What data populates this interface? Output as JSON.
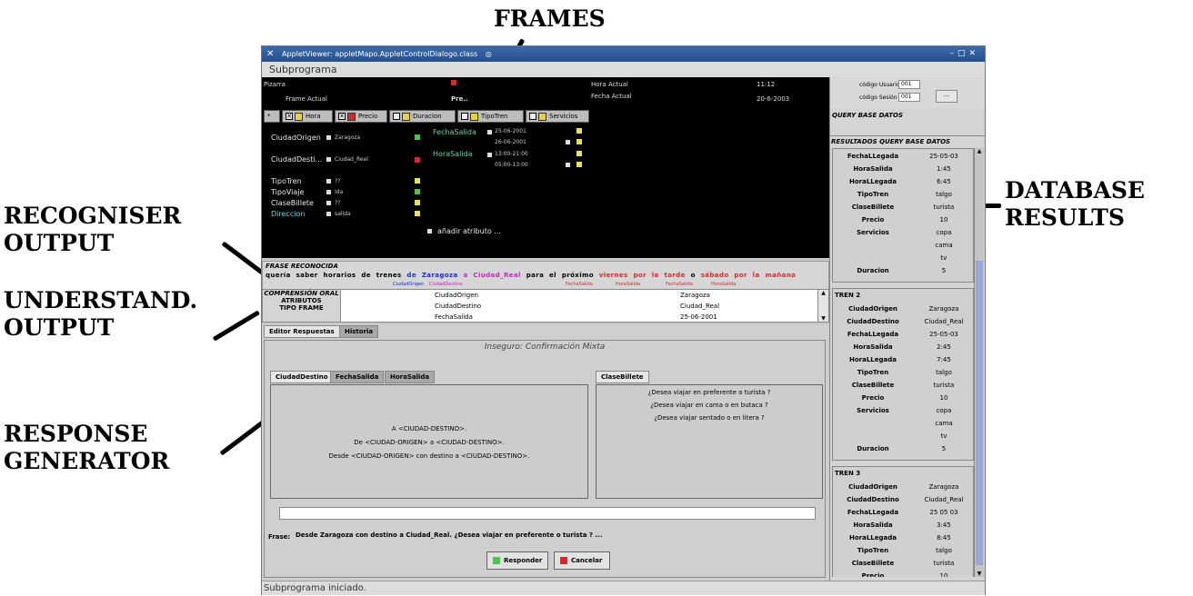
{
  "annotations": {
    "frames": "FRAMES",
    "recogniser": [
      "RECOGNISER",
      "OUTPUT"
    ],
    "understand": [
      "UNDERSTAND.",
      "OUTPUT"
    ],
    "response": [
      "RESPONSE",
      "GENERATOR"
    ],
    "database": [
      "DATABASE",
      "RESULTS"
    ]
  },
  "window": {
    "title": "AppletViewer: appletMapo.AppletControlDialogo.class",
    "menu": "Subprograma",
    "status": "Subprograma iniciado."
  },
  "header": {
    "pizarra": "Pizarra",
    "frame_actual_label": "Frame Actual",
    "frame_actual_value": "Pre..",
    "hora_actual_label": "Hora Actual",
    "hora_actual_value": "11:12",
    "fecha_actual_label": "Fecha Actual",
    "fecha_actual_value": "20-6-2003"
  },
  "frame_tabs": [
    {
      "label": "Hora",
      "color": "#e8d23a"
    },
    {
      "label": "Precio",
      "color": "#d42a2a"
    },
    {
      "label": "Duracion",
      "color": "#e8d23a"
    },
    {
      "label": "TipoTren",
      "color": "#e8d23a"
    },
    {
      "label": "Servicios",
      "color": "#e8d23a"
    }
  ],
  "slots_left": [
    {
      "name": "CiudadOrigen",
      "value": "Zaragoza",
      "color": "#4bc44b"
    },
    {
      "name": "CiudadDesti...",
      "value": "Ciudad_Real",
      "color": "#d42a2a"
    },
    {
      "name": "TipoTren",
      "value": "??",
      "color": "#e8e25a"
    },
    {
      "name": "TipoViaje",
      "value": "Ida",
      "color": "#4bc44b"
    },
    {
      "name": "ClaseBillete",
      "value": "??",
      "color": "#e8e25a"
    },
    {
      "name": "Direccion",
      "value": "salida",
      "color": "#e8e25a"
    }
  ],
  "slots_right": {
    "fecha_label": "FechaSalida",
    "fecha_values": [
      "25-06-2001",
      "26-06-2001"
    ],
    "hora_label": "HoraSalida",
    "hora_values": [
      "13:00-21:00",
      "05:00-13:00"
    ],
    "add_attr": "añadir atributo ..."
  },
  "recognised": {
    "label": "FRASE RECONOCIDA",
    "words": [
      {
        "t": "quería saber horarios de trenes",
        "c": "#000000"
      },
      {
        "t": "de",
        "c": "#1a2ccf"
      },
      {
        "t": "Zaragoza",
        "c": "#1a2ccf"
      },
      {
        "t": "a",
        "c": "#c425c4"
      },
      {
        "t": "Ciudad_Real",
        "c": "#c425c4"
      },
      {
        "t": "para el próximo",
        "c": "#000000"
      },
      {
        "t": "viernes",
        "c": "#d42a2a"
      },
      {
        "t": "por la tarde",
        "c": "#d42a2a"
      },
      {
        "t": "o",
        "c": "#000000"
      },
      {
        "t": "sábado",
        "c": "#d42a2a"
      },
      {
        "t": "por la mañana",
        "c": "#d42a2a"
      }
    ],
    "sublabels": [
      {
        "t": "CiudadOrigen",
        "c": "#1a2ccf"
      },
      {
        "t": "CiudadDestino",
        "c": "#c425c4"
      },
      {
        "t": "FechaSalida",
        "c": "#d42a2a"
      },
      {
        "t": "HoraSalida",
        "c": "#d42a2a"
      },
      {
        "t": "FechaSalida",
        "c": "#d42a2a"
      },
      {
        "t": "HoraSalida",
        "c": "#d42a2a"
      }
    ]
  },
  "comprension": {
    "label": "COMPRENSIÓN ORAL",
    "atributos": "ATRIBUTOS",
    "tipo_frame": "TIPO FRAME",
    "rows": [
      {
        "attr": "CiudadOrigen",
        "value": "Zaragoza"
      },
      {
        "attr": "CiudadDestino",
        "value": "Ciudad_Real"
      },
      {
        "attr": "FechaSalida",
        "value": "25-06-2001"
      }
    ]
  },
  "responses": {
    "tabs": [
      "Editor Respuestas",
      "Historia"
    ],
    "heading": "Inseguro: Confirmación Mixta",
    "left_tabs": [
      "CiudadDestino",
      "FechaSalida",
      "HoraSalida"
    ],
    "right_tab": "ClaseBillete",
    "left_lines": [
      "A <CIUDAD-DESTINO>.",
      "De <CIUDAD-ORIGEN> a <CIUDAD-DESTINO>.",
      "Desde <CIUDAD-ORIGEN> con destino a <CIUDAD-DESTINO>."
    ],
    "right_lines": [
      "¿Desea viajar en preferente o turista ?",
      "¿Desea viajar en cama o en butaca ?",
      "¿Desea viajar sentado o en litera ?"
    ],
    "frase_label": "Frase:",
    "frase_value": "Desde Zaragoza con destino a Ciudad_Real. ¿Desea viajar en preferente o turista ? ...",
    "responder": "Responder",
    "cancelar": "Cancelar"
  },
  "query": {
    "codigo_usuario_label": "código Usuario",
    "codigo_usuario_value": "001",
    "codigo_sesion_label": "código Sesión",
    "codigo_sesion_value": "001",
    "more_button": "...",
    "query_label": "QUERY BASE DATOS",
    "results_label": "RESULTADOS QUERY BASE DATOS"
  },
  "results": [
    {
      "header": "",
      "rows": [
        [
          "FechaLLegada",
          "25-05-03"
        ],
        [
          "HoraSalida",
          "1:45"
        ],
        [
          "HoraLLegada",
          "6:45"
        ],
        [
          "TipoTren",
          "talgo"
        ],
        [
          "ClaseBillete",
          "turista"
        ],
        [
          "Precio",
          "10"
        ],
        [
          "Servicios",
          "copa"
        ],
        [
          "",
          "cama"
        ],
        [
          "",
          "tv"
        ],
        [
          "Duracion",
          "5"
        ]
      ]
    },
    {
      "header": "TREN 2",
      "rows": [
        [
          "CiudadOrigen",
          "Zaragoza"
        ],
        [
          "CiudadDestino",
          "Ciudad_Real"
        ],
        [
          "FechaLLegada",
          "25-05-03"
        ],
        [
          "HoraSalida",
          "2:45"
        ],
        [
          "HoraLLegada",
          "7:45"
        ],
        [
          "TipoTren",
          "talgo"
        ],
        [
          "ClaseBillete",
          "turista"
        ],
        [
          "Precio",
          "10"
        ],
        [
          "Servicios",
          "copa"
        ],
        [
          "",
          "cama"
        ],
        [
          "",
          "tv"
        ],
        [
          "Duracion",
          "5"
        ]
      ]
    },
    {
      "header": "TREN 3",
      "rows": [
        [
          "CiudadOrigen",
          "Zaragoza"
        ],
        [
          "CiudadDestino",
          "Ciudad_Real"
        ],
        [
          "FechaLLegada",
          "25 05 03"
        ],
        [
          "HoraSalida",
          "3:45"
        ],
        [
          "HoraLLegada",
          "8:45"
        ],
        [
          "TipoTren",
          "talgo"
        ],
        [
          "ClaseBillete",
          "turista"
        ],
        [
          "Precio",
          "10"
        ]
      ]
    }
  ]
}
